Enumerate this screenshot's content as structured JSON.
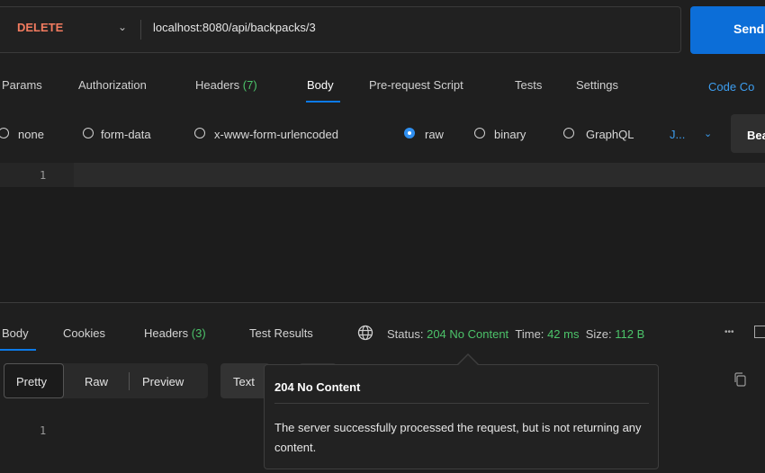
{
  "request": {
    "method": "DELETE",
    "url": "localhost:8080/api/backpacks/3",
    "send_label": "Send"
  },
  "request_tabs": [
    {
      "label": "Params"
    },
    {
      "label": "Authorization"
    },
    {
      "label": "Headers",
      "count": "(7)"
    },
    {
      "label": "Body",
      "active": true
    },
    {
      "label": "Pre-request Script"
    },
    {
      "label": "Tests"
    },
    {
      "label": "Settings"
    }
  ],
  "code_link": "Code",
  "cookies_link": "Co",
  "body_types": [
    {
      "label": "none"
    },
    {
      "label": "form-data"
    },
    {
      "label": "x-www-form-urlencoded"
    },
    {
      "label": "raw",
      "selected": true
    },
    {
      "label": "binary"
    },
    {
      "label": "GraphQL"
    }
  ],
  "raw_format": "J...",
  "beautify_label": "Bea",
  "editor": {
    "line_number": "1"
  },
  "response_tabs": [
    {
      "label": "Body",
      "active": true
    },
    {
      "label": "Cookies"
    },
    {
      "label": "Headers",
      "count": "(3)"
    },
    {
      "label": "Test Results"
    }
  ],
  "status": {
    "status_label": "Status:",
    "status_value": "204 No Content",
    "time_label": "Time:",
    "time_value": "42 ms",
    "size_label": "Size:",
    "size_value": "112 B",
    "more": "•••"
  },
  "view_modes": {
    "pretty": "Pretty",
    "raw": "Raw",
    "preview": "Preview",
    "text": "Text"
  },
  "response_editor": {
    "line_number": "1"
  },
  "tooltip": {
    "title": "204 No Content",
    "description": "The server successfully processed the request, but is not returning any content."
  },
  "icons": {
    "globe": "globe-icon",
    "copy": "copy-icon",
    "chevron": "chevron-down-icon"
  },
  "colors": {
    "method": "#f27b5f",
    "accent": "#0c6ed8",
    "status_ok": "#4cc36a"
  }
}
